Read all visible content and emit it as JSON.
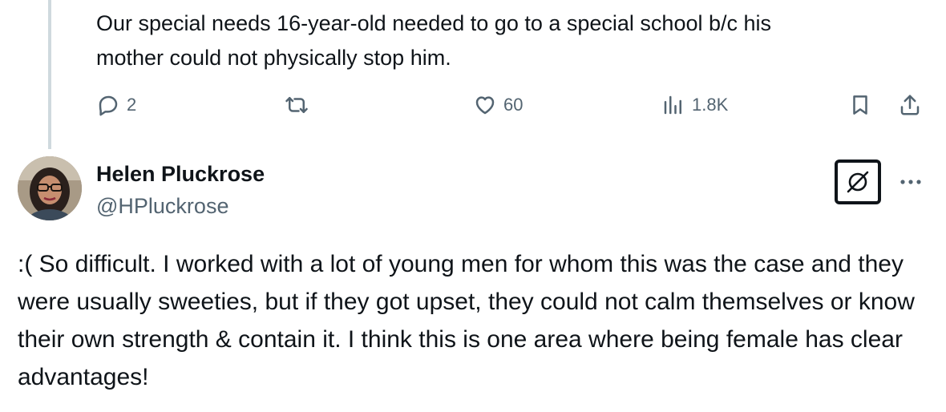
{
  "parent_tweet": {
    "text": "Our special needs 16-year-old needed to go to a special school b/c his\nmother could not physically stop him.",
    "actions": {
      "reply_icon": "comment-icon",
      "reply_count": "2",
      "repost_icon": "repost-icon",
      "like_icon": "heart-icon",
      "like_count": "60",
      "views_icon": "analytics-icon",
      "views_count": "1.8K",
      "bookmark_icon": "bookmark-icon",
      "share_icon": "share-icon"
    }
  },
  "reply_tweet": {
    "author_name": "Helen Pluckrose",
    "author_handle": "@HPluckrose",
    "grok_icon": "grok-icon",
    "more_icon": "more-icon",
    "text": ":( So difficult. I worked with a lot of young men for whom this was the case and they were usually sweeties, but if they got upset, they could not calm themselves or know their own strength & contain it. I think this is one area where being female has clear advantages!"
  },
  "colors": {
    "text_primary": "#0f1419",
    "text_secondary": "#536471",
    "thread_line": "#cfd9de"
  }
}
